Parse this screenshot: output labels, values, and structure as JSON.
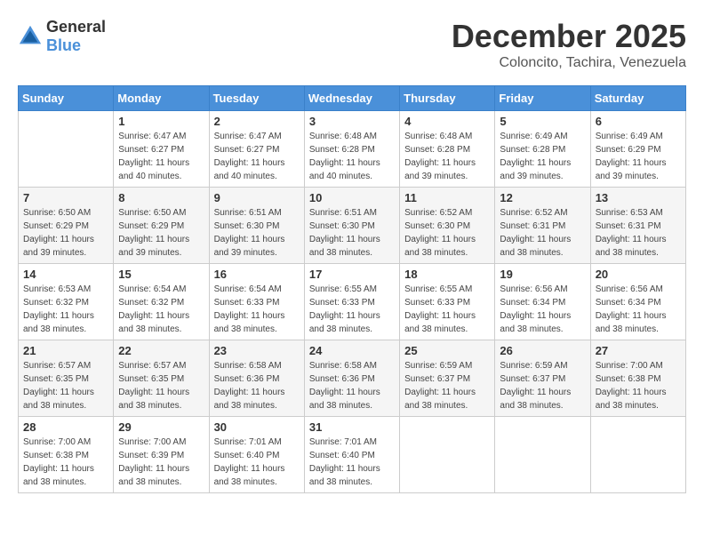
{
  "logo": {
    "general": "General",
    "blue": "Blue"
  },
  "header": {
    "month": "December 2025",
    "location": "Coloncito, Tachira, Venezuela"
  },
  "weekdays": [
    "Sunday",
    "Monday",
    "Tuesday",
    "Wednesday",
    "Thursday",
    "Friday",
    "Saturday"
  ],
  "weeks": [
    [
      {
        "day": "",
        "sunrise": "",
        "sunset": "",
        "daylight": ""
      },
      {
        "day": "1",
        "sunrise": "Sunrise: 6:47 AM",
        "sunset": "Sunset: 6:27 PM",
        "daylight": "Daylight: 11 hours and 40 minutes."
      },
      {
        "day": "2",
        "sunrise": "Sunrise: 6:47 AM",
        "sunset": "Sunset: 6:27 PM",
        "daylight": "Daylight: 11 hours and 40 minutes."
      },
      {
        "day": "3",
        "sunrise": "Sunrise: 6:48 AM",
        "sunset": "Sunset: 6:28 PM",
        "daylight": "Daylight: 11 hours and 40 minutes."
      },
      {
        "day": "4",
        "sunrise": "Sunrise: 6:48 AM",
        "sunset": "Sunset: 6:28 PM",
        "daylight": "Daylight: 11 hours and 39 minutes."
      },
      {
        "day": "5",
        "sunrise": "Sunrise: 6:49 AM",
        "sunset": "Sunset: 6:28 PM",
        "daylight": "Daylight: 11 hours and 39 minutes."
      },
      {
        "day": "6",
        "sunrise": "Sunrise: 6:49 AM",
        "sunset": "Sunset: 6:29 PM",
        "daylight": "Daylight: 11 hours and 39 minutes."
      }
    ],
    [
      {
        "day": "7",
        "sunrise": "Sunrise: 6:50 AM",
        "sunset": "Sunset: 6:29 PM",
        "daylight": "Daylight: 11 hours and 39 minutes."
      },
      {
        "day": "8",
        "sunrise": "Sunrise: 6:50 AM",
        "sunset": "Sunset: 6:29 PM",
        "daylight": "Daylight: 11 hours and 39 minutes."
      },
      {
        "day": "9",
        "sunrise": "Sunrise: 6:51 AM",
        "sunset": "Sunset: 6:30 PM",
        "daylight": "Daylight: 11 hours and 39 minutes."
      },
      {
        "day": "10",
        "sunrise": "Sunrise: 6:51 AM",
        "sunset": "Sunset: 6:30 PM",
        "daylight": "Daylight: 11 hours and 38 minutes."
      },
      {
        "day": "11",
        "sunrise": "Sunrise: 6:52 AM",
        "sunset": "Sunset: 6:30 PM",
        "daylight": "Daylight: 11 hours and 38 minutes."
      },
      {
        "day": "12",
        "sunrise": "Sunrise: 6:52 AM",
        "sunset": "Sunset: 6:31 PM",
        "daylight": "Daylight: 11 hours and 38 minutes."
      },
      {
        "day": "13",
        "sunrise": "Sunrise: 6:53 AM",
        "sunset": "Sunset: 6:31 PM",
        "daylight": "Daylight: 11 hours and 38 minutes."
      }
    ],
    [
      {
        "day": "14",
        "sunrise": "Sunrise: 6:53 AM",
        "sunset": "Sunset: 6:32 PM",
        "daylight": "Daylight: 11 hours and 38 minutes."
      },
      {
        "day": "15",
        "sunrise": "Sunrise: 6:54 AM",
        "sunset": "Sunset: 6:32 PM",
        "daylight": "Daylight: 11 hours and 38 minutes."
      },
      {
        "day": "16",
        "sunrise": "Sunrise: 6:54 AM",
        "sunset": "Sunset: 6:33 PM",
        "daylight": "Daylight: 11 hours and 38 minutes."
      },
      {
        "day": "17",
        "sunrise": "Sunrise: 6:55 AM",
        "sunset": "Sunset: 6:33 PM",
        "daylight": "Daylight: 11 hours and 38 minutes."
      },
      {
        "day": "18",
        "sunrise": "Sunrise: 6:55 AM",
        "sunset": "Sunset: 6:33 PM",
        "daylight": "Daylight: 11 hours and 38 minutes."
      },
      {
        "day": "19",
        "sunrise": "Sunrise: 6:56 AM",
        "sunset": "Sunset: 6:34 PM",
        "daylight": "Daylight: 11 hours and 38 minutes."
      },
      {
        "day": "20",
        "sunrise": "Sunrise: 6:56 AM",
        "sunset": "Sunset: 6:34 PM",
        "daylight": "Daylight: 11 hours and 38 minutes."
      }
    ],
    [
      {
        "day": "21",
        "sunrise": "Sunrise: 6:57 AM",
        "sunset": "Sunset: 6:35 PM",
        "daylight": "Daylight: 11 hours and 38 minutes."
      },
      {
        "day": "22",
        "sunrise": "Sunrise: 6:57 AM",
        "sunset": "Sunset: 6:35 PM",
        "daylight": "Daylight: 11 hours and 38 minutes."
      },
      {
        "day": "23",
        "sunrise": "Sunrise: 6:58 AM",
        "sunset": "Sunset: 6:36 PM",
        "daylight": "Daylight: 11 hours and 38 minutes."
      },
      {
        "day": "24",
        "sunrise": "Sunrise: 6:58 AM",
        "sunset": "Sunset: 6:36 PM",
        "daylight": "Daylight: 11 hours and 38 minutes."
      },
      {
        "day": "25",
        "sunrise": "Sunrise: 6:59 AM",
        "sunset": "Sunset: 6:37 PM",
        "daylight": "Daylight: 11 hours and 38 minutes."
      },
      {
        "day": "26",
        "sunrise": "Sunrise: 6:59 AM",
        "sunset": "Sunset: 6:37 PM",
        "daylight": "Daylight: 11 hours and 38 minutes."
      },
      {
        "day": "27",
        "sunrise": "Sunrise: 7:00 AM",
        "sunset": "Sunset: 6:38 PM",
        "daylight": "Daylight: 11 hours and 38 minutes."
      }
    ],
    [
      {
        "day": "28",
        "sunrise": "Sunrise: 7:00 AM",
        "sunset": "Sunset: 6:38 PM",
        "daylight": "Daylight: 11 hours and 38 minutes."
      },
      {
        "day": "29",
        "sunrise": "Sunrise: 7:00 AM",
        "sunset": "Sunset: 6:39 PM",
        "daylight": "Daylight: 11 hours and 38 minutes."
      },
      {
        "day": "30",
        "sunrise": "Sunrise: 7:01 AM",
        "sunset": "Sunset: 6:40 PM",
        "daylight": "Daylight: 11 hours and 38 minutes."
      },
      {
        "day": "31",
        "sunrise": "Sunrise: 7:01 AM",
        "sunset": "Sunset: 6:40 PM",
        "daylight": "Daylight: 11 hours and 38 minutes."
      },
      {
        "day": "",
        "sunrise": "",
        "sunset": "",
        "daylight": ""
      },
      {
        "day": "",
        "sunrise": "",
        "sunset": "",
        "daylight": ""
      },
      {
        "day": "",
        "sunrise": "",
        "sunset": "",
        "daylight": ""
      }
    ]
  ]
}
